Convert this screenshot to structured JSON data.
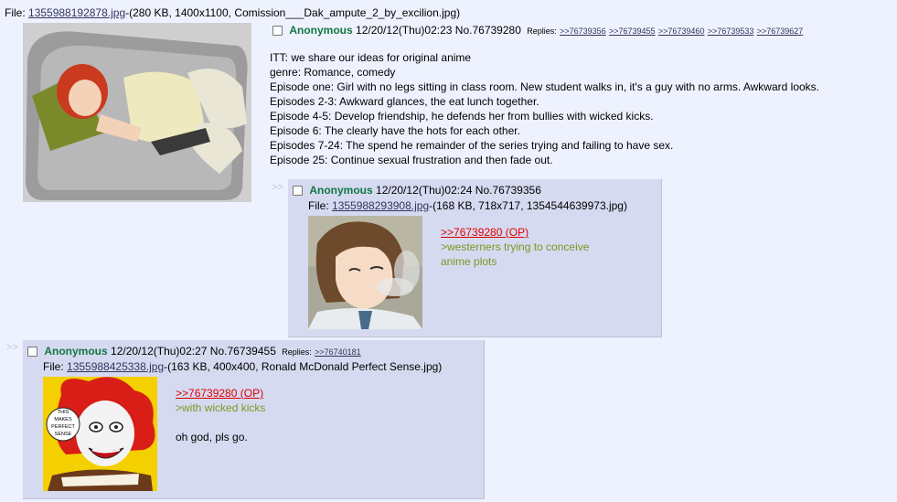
{
  "op": {
    "file_prefix": "File: ",
    "file_link": "1355988192878.jpg",
    "file_info": "-(280 KB, 1400x1100, Comission___Dak_ampute_2_by_excilion.jpg)",
    "name": "Anonymous",
    "datetime": "12/20/12(Thu)02:23",
    "postno": "No.76739280",
    "replies_label": "Replies:",
    "replies": [
      ">>76739356",
      ">>76739455",
      ">>76739460",
      ">>76739533",
      ">>76739627"
    ],
    "message": [
      "ITT: we share our ideas for original anime",
      "genre: Romance, comedy",
      "Episode one: Girl with no legs sitting in class room. New student walks in, it's a guy with no arms. Awkward looks.",
      "Episodes 2-3: Awkward glances, the eat lunch together.",
      "Episode 4-5: Develop friendship, he defends her from bullies with wicked kicks.",
      "Episode 6: The clearly have the hots for each other.",
      "Episodes 7-24: The spend he remainder of the series trying and failing to have sex.",
      "Episode 25: Continue sexual frustration and then fade out."
    ]
  },
  "reply1": {
    "arrows": ">>",
    "name": "Anonymous",
    "datetime": "12/20/12(Thu)02:24",
    "postno": "No.76739356",
    "file_prefix": "File: ",
    "file_link": "1355988293908.jpg",
    "file_info": "-(168 KB, 718x717, 1354544639973.jpg)",
    "quote": ">>76739280 (OP)",
    "greentext": [
      ">westerners trying to conceive",
      "anime plots"
    ]
  },
  "reply2": {
    "arrows": ">>",
    "name": "Anonymous",
    "datetime": "12/20/12(Thu)02:27",
    "postno": "No.76739455",
    "replies_label": "Replies:",
    "replies": [
      ">>76740181"
    ],
    "file_prefix": "File: ",
    "file_link": "1355988425338.jpg",
    "file_info": "-(163 KB, 400x400, Ronald McDonald Perfect Sense.jpg)",
    "quote": ">>76739280 (OP)",
    "greentext": ">with wicked kicks",
    "text": "oh god, pls go.",
    "image_caption": "THIS MAKES PERFECT SENSE"
  },
  "colors": {
    "background": "#eef2ff",
    "reply_bg": "#d6daf0",
    "name": "#117743",
    "quote": "#dd0000",
    "greentext": "#789922",
    "link": "#34345c"
  }
}
